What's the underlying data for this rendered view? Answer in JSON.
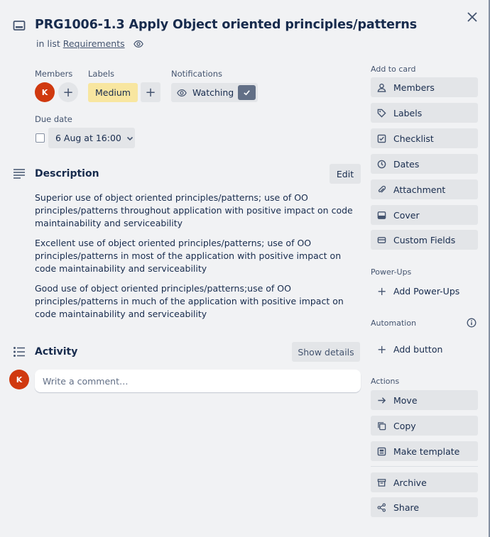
{
  "card": {
    "title": "PRG1006-1.3 Apply Object oriented principles/patterns",
    "in_list_prefix": "in list",
    "list_name": "Requirements"
  },
  "members": {
    "label": "Members",
    "avatar_initial": "K"
  },
  "labels": {
    "label": "Labels",
    "chip": "Medium",
    "chip_color": "#f8e6a0"
  },
  "notifications": {
    "label": "Notifications",
    "button": "Watching"
  },
  "due_date": {
    "label": "Due date",
    "value": "6 Aug at 16:00"
  },
  "description": {
    "title": "Description",
    "edit": "Edit",
    "paragraphs": [
      "Superior use of object oriented principles/patterns; use of OO principles/patterns throughout application with positive impact on code maintainability and serviceability",
      "Excellent use of object oriented principles/patterns; use of OO principles/patterns in most of the application with positive impact on code maintainability and serviceability",
      "Good use of object oriented principles/patterns;use of OO principles/patterns in much of the application with positive impact on code maintainability and serviceability"
    ]
  },
  "activity": {
    "title": "Activity",
    "show_details": "Show details",
    "avatar_initial": "K",
    "comment_placeholder": "Write a comment…"
  },
  "sidebar": {
    "add_to_card_label": "Add to card",
    "add_to_card": [
      "Members",
      "Labels",
      "Checklist",
      "Dates",
      "Attachment",
      "Cover",
      "Custom Fields"
    ],
    "powerups_label": "Power-Ups",
    "add_powerups": "Add Power-Ups",
    "automation_label": "Automation",
    "add_button": "Add button",
    "actions_label": "Actions",
    "actions": [
      "Move",
      "Copy",
      "Make template",
      "Archive",
      "Share"
    ]
  },
  "colors": {
    "avatar": "#d0390f",
    "background": "#f1f2f4",
    "button": "#e3e5e8"
  }
}
